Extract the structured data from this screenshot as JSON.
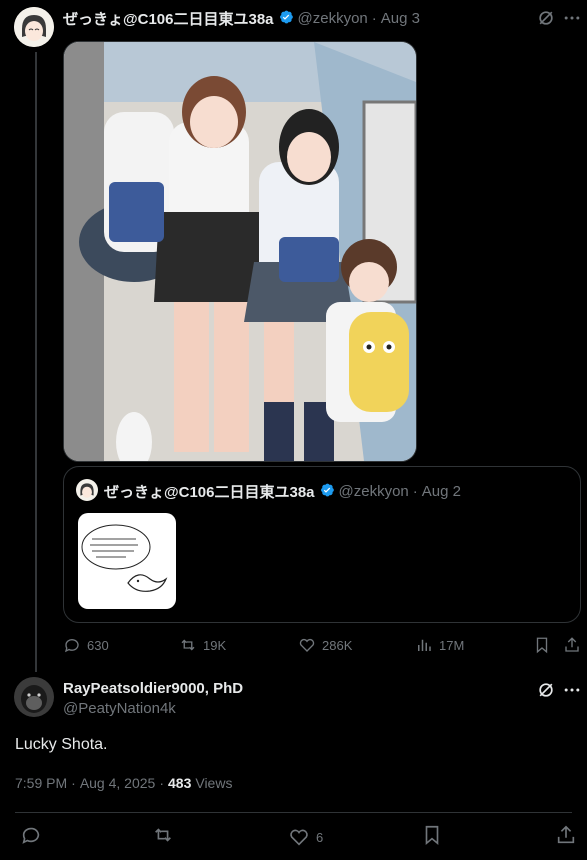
{
  "parent_tweet": {
    "display_name": "ぜっきょ@C106二日目東ユ38a",
    "handle": "@zekkyon",
    "separator": "·",
    "date": "Aug 3",
    "image_alt": "manga illustration"
  },
  "quoted_tweet": {
    "display_name": "ぜっきょ@C106二日目東ユ38a",
    "handle": "@zekkyon",
    "separator": "·",
    "date": "Aug 2"
  },
  "parent_actions": {
    "replies": "630",
    "reposts": "19K",
    "likes": "286K",
    "views": "17M"
  },
  "reply_tweet": {
    "display_name": "RayPeatsoldier9000, PhD",
    "handle": "@PeatyNation4k",
    "text": "Lucky Shota.",
    "time": "7:59 PM",
    "separator": "·",
    "date": "Aug 4, 2025",
    "views_count": "483",
    "views_label": "Views"
  },
  "reply_actions": {
    "likes": "6"
  },
  "colors": {
    "background": "#000000",
    "text": "#e7e9ea",
    "muted": "#71767b",
    "verified": "#1d9bf0",
    "border": "#2f3336"
  }
}
